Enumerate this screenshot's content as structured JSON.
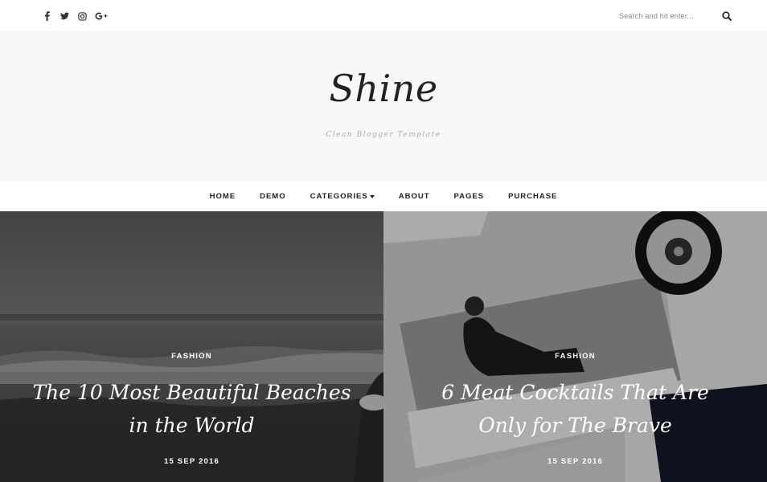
{
  "social": {
    "icons": [
      "facebook-icon",
      "twitter-icon",
      "instagram-icon",
      "google-plus-icon"
    ]
  },
  "search": {
    "placeholder": "Search and hit enter..."
  },
  "header": {
    "title": "Shine",
    "tagline": "Clean Blogger Template"
  },
  "nav": {
    "items": [
      {
        "label": "HOME"
      },
      {
        "label": "DEMO"
      },
      {
        "label": "CATEGORIES"
      },
      {
        "label": "ABOUT"
      },
      {
        "label": "PAGES"
      },
      {
        "label": "PURCHASE"
      }
    ]
  },
  "featured": [
    {
      "category": "FASHION",
      "title": "The 10 Most Beautiful Beaches in the World",
      "date": "15 SEP 2016"
    },
    {
      "category": "FASHION",
      "title": "6 Meat Cocktails That Are Only for The Brave",
      "date": "15 SEP 2016"
    }
  ],
  "colors": {
    "header_bg": "#f8f8f8",
    "text": "#222222",
    "overlay_text": "#ffffff"
  }
}
